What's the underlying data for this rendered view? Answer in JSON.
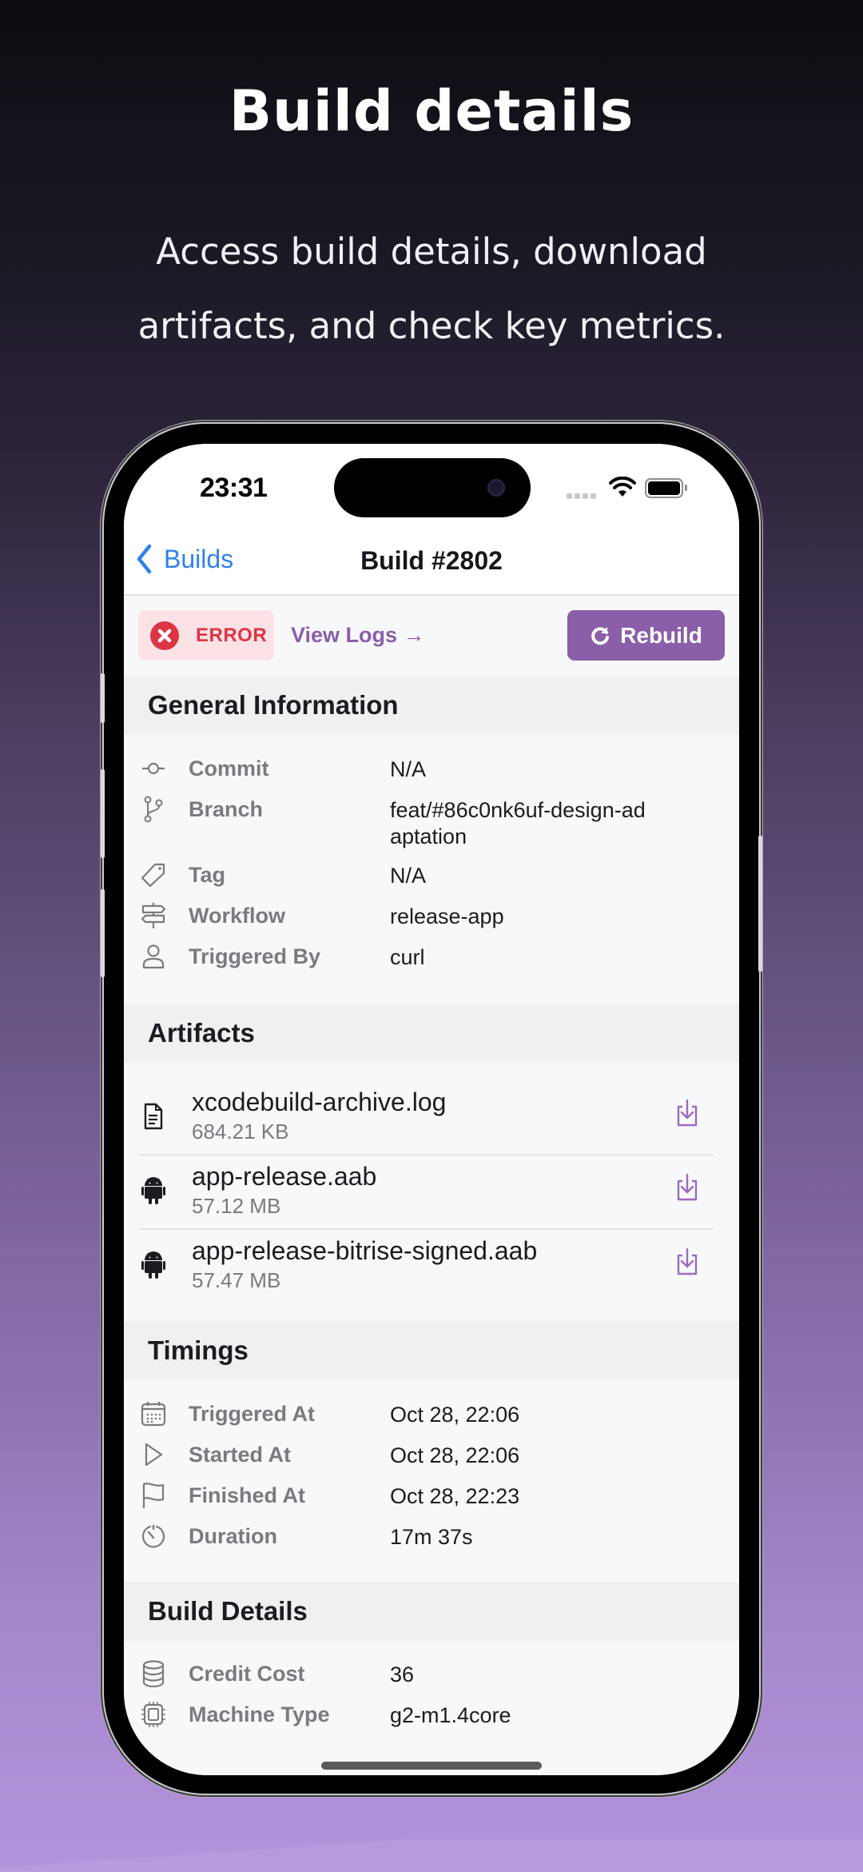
{
  "hero": {
    "title": "Build details",
    "subtitle": "Access build details, download artifacts, and check key metrics."
  },
  "status_bar": {
    "time": "23:31",
    "icons": [
      "cellular-signal-icon",
      "wifi-icon",
      "battery-icon"
    ]
  },
  "nav": {
    "back_label": "Builds",
    "title": "Build #2802"
  },
  "actions": {
    "status_badge": "ERROR",
    "status_color": "#dc3545",
    "view_logs": "View Logs →",
    "rebuild": "Rebuild",
    "accent_color": "#8a5ea8"
  },
  "sections": {
    "general": {
      "title": "General Information",
      "rows": [
        {
          "icon": "commit-icon",
          "label": "Commit",
          "value": "N/A"
        },
        {
          "icon": "branch-icon",
          "label": "Branch",
          "value": "feat/#86c0nk6uf-design-adaptation"
        },
        {
          "icon": "tag-icon",
          "label": "Tag",
          "value": "N/A"
        },
        {
          "icon": "workflow-signpost-icon",
          "label": "Workflow",
          "value": "release-app"
        },
        {
          "icon": "user-icon",
          "label": "Triggered By",
          "value": "curl"
        }
      ]
    },
    "artifacts": {
      "title": "Artifacts",
      "items": [
        {
          "icon": "document-icon",
          "name": "xcodebuild-archive.log",
          "size": "684.21 KB"
        },
        {
          "icon": "android-icon",
          "name": "app-release.aab",
          "size": "57.12 MB"
        },
        {
          "icon": "android-icon",
          "name": "app-release-bitrise-signed.aab",
          "size": "57.47 MB"
        }
      ]
    },
    "timings": {
      "title": "Timings",
      "rows": [
        {
          "icon": "calendar-icon",
          "label": "Triggered At",
          "value": "Oct 28, 22:06"
        },
        {
          "icon": "play-icon",
          "label": "Started At",
          "value": "Oct 28, 22:06"
        },
        {
          "icon": "flag-icon",
          "label": "Finished At",
          "value": "Oct 28, 22:23"
        },
        {
          "icon": "stopwatch-icon",
          "label": "Duration",
          "value": "17m 37s"
        }
      ]
    },
    "build_details": {
      "title": "Build Details",
      "rows": [
        {
          "icon": "database-coins-icon",
          "label": "Credit Cost",
          "value": "36"
        },
        {
          "icon": "cpu-chip-icon",
          "label": "Machine Type",
          "value": "g2-m1.4core"
        }
      ]
    }
  }
}
